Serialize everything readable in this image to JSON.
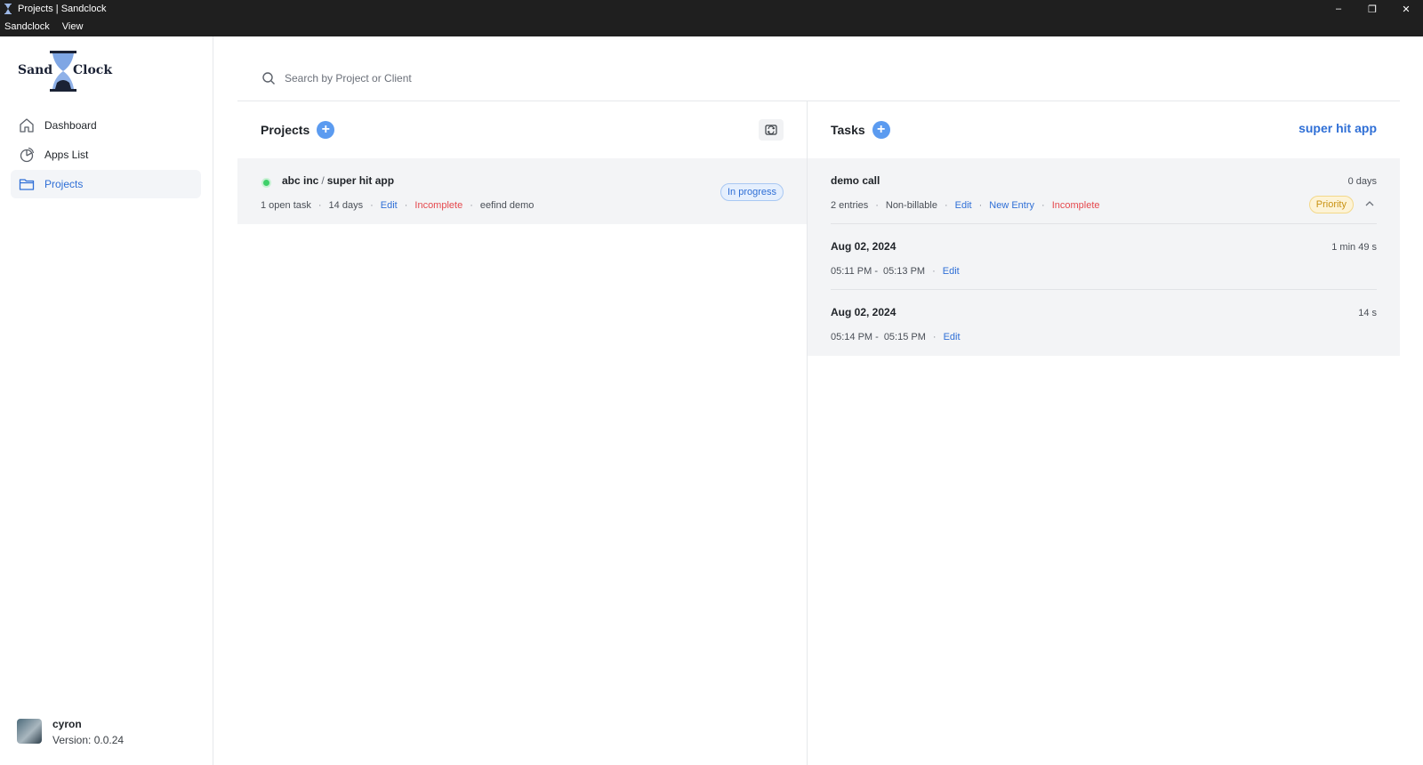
{
  "window": {
    "title": "Projects | Sandclock",
    "menu": [
      "Sandclock",
      "View"
    ],
    "controls": {
      "minimize": "–",
      "restore": "❐",
      "close": "✕"
    }
  },
  "logo": {
    "left": "Sand",
    "right": "Clock"
  },
  "sidebar": {
    "items": [
      {
        "label": "Dashboard",
        "icon": "home-icon"
      },
      {
        "label": "Apps List",
        "icon": "pie-chart-icon"
      },
      {
        "label": "Projects",
        "icon": "folder-icon",
        "active": true
      }
    ],
    "user": {
      "name": "cyron",
      "version": "Version: 0.0.24"
    }
  },
  "search": {
    "placeholder": "Search by Project or Client",
    "value": ""
  },
  "projects": {
    "title": "Projects",
    "add": "+",
    "items": [
      {
        "client": "abc inc",
        "separator": "/",
        "name": "super hit app",
        "open_tasks": "1 open task",
        "duration": "14 days",
        "edit": "Edit",
        "state": "Incomplete",
        "extra": "eefind demo",
        "status": "In progress",
        "status_color": "#3fd06a"
      }
    ]
  },
  "tasks": {
    "title": "Tasks",
    "add": "+",
    "project_link": "super hit app",
    "task": {
      "name": "demo call",
      "duration": "0 days",
      "entries": "2 entries",
      "billing": "Non-billable",
      "edit": "Edit",
      "new_entry": "New Entry",
      "state": "Incomplete",
      "priority": "Priority"
    },
    "entries": [
      {
        "date": "Aug 02, 2024",
        "duration": "1 min 49 s",
        "start": "05:11 PM -",
        "end": "05:13 PM",
        "edit": "Edit"
      },
      {
        "date": "Aug 02, 2024",
        "duration": "14 s",
        "start": "05:14 PM -",
        "end": "05:15 PM",
        "edit": "Edit"
      }
    ]
  },
  "colors": {
    "accent": "#2f6fd6",
    "danger": "#e5484d",
    "success": "#3fd06a",
    "warning": "#c99212"
  }
}
